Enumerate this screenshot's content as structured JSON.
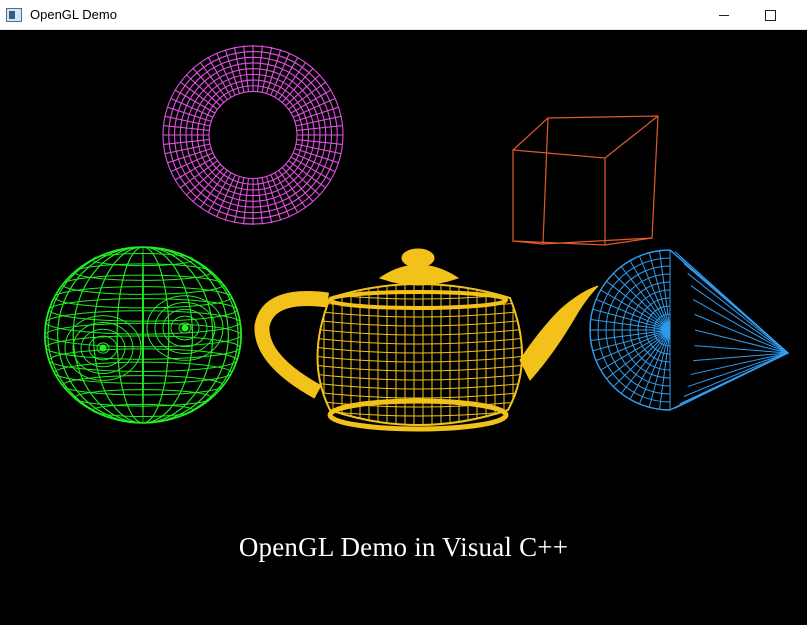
{
  "window": {
    "title": "OpenGL Demo",
    "icon": "opengl-app-icon",
    "controls": {
      "minimize_icon": "minimize-icon",
      "maximize_icon": "maximize-icon"
    }
  },
  "scene": {
    "caption": "OpenGL Demo in Visual C++",
    "background": "#000000",
    "objects": [
      {
        "name": "torus",
        "color": "#e050e0"
      },
      {
        "name": "cube",
        "color": "#e05a2a"
      },
      {
        "name": "sphere",
        "color": "#22ee22"
      },
      {
        "name": "teapot",
        "color": "#f2c21a"
      },
      {
        "name": "cone",
        "color": "#2f9df0"
      }
    ]
  }
}
